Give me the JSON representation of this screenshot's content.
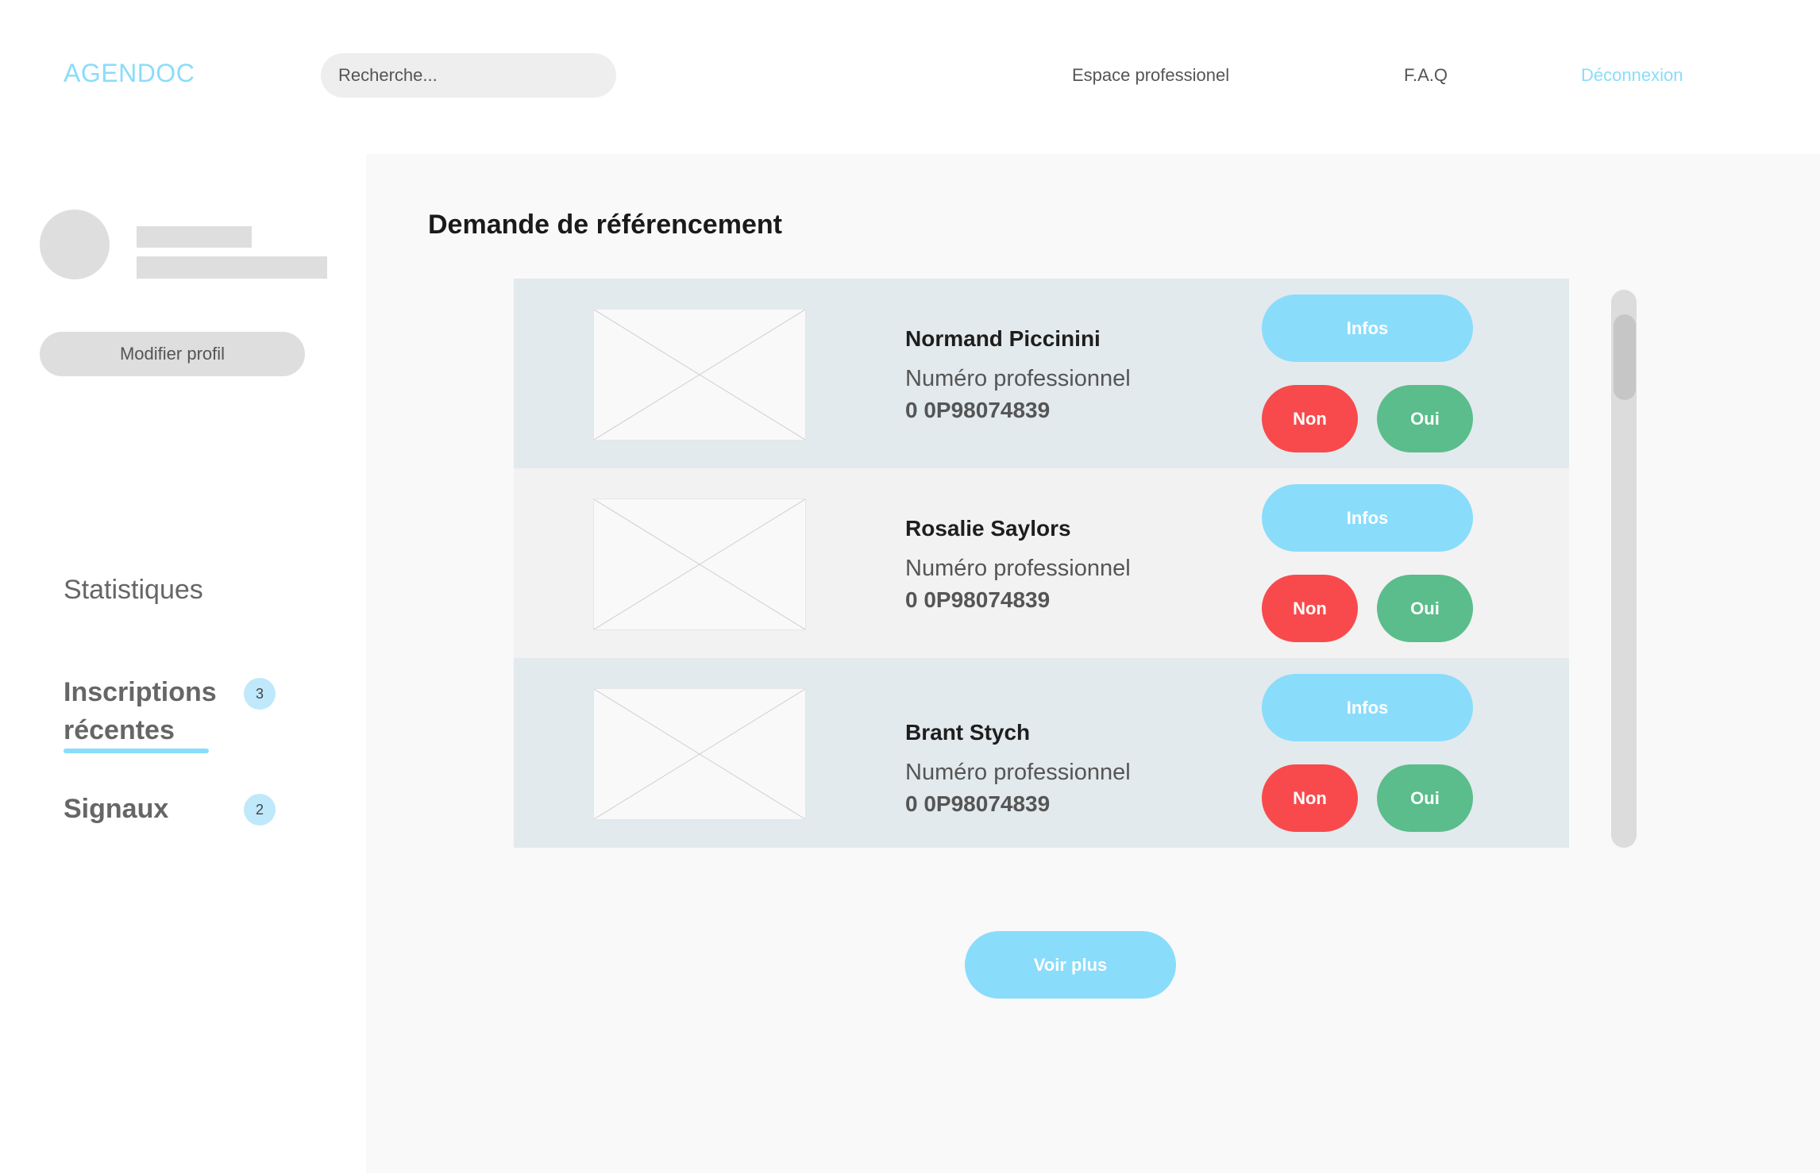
{
  "header": {
    "logo": "AGENDOC",
    "search_placeholder": "Recherche...",
    "nav": {
      "pro": "Espace professionel",
      "faq": "F.A.Q",
      "logout": "Déconnexion"
    }
  },
  "sidebar": {
    "edit_profile": "Modifier profil",
    "stats": "Statistiques",
    "inscriptions": "Inscriptions récentes",
    "inscriptions_count": "3",
    "signaux": "Signaux",
    "signaux_count": "2"
  },
  "main": {
    "title": "Demande de référencement",
    "requests": [
      {
        "name": "Normand Piccinini",
        "num_label": "Numéro professionnel",
        "number": "0 0P98074839",
        "infos": "Infos",
        "non": "Non",
        "oui": "Oui"
      },
      {
        "name": "Rosalie Saylors",
        "num_label": "Numéro professionnel",
        "number": "0 0P98074839",
        "infos": "Infos",
        "non": "Non",
        "oui": "Oui"
      },
      {
        "name": "Brant Stych",
        "num_label": "Numéro professionnel",
        "number": "0 0P98074839",
        "infos": "Infos",
        "non": "Non",
        "oui": "Oui"
      }
    ],
    "more": "Voir plus"
  },
  "colors": {
    "accent": "#8adcfb",
    "reject": "#f84a4c",
    "accept": "#5abd8b"
  }
}
